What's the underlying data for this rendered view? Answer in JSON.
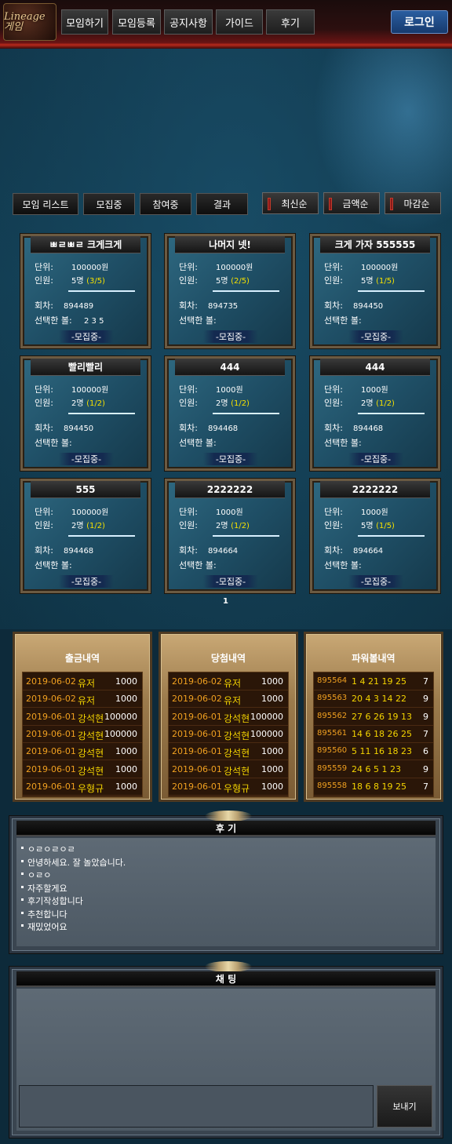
{
  "header": {
    "logo_text": "Lineage 게임",
    "nav": [
      "모임하기",
      "모임등록",
      "공지사항",
      "가이드",
      "후기"
    ],
    "login_label": "로그인"
  },
  "filters": {
    "tabs": [
      "모임 리스트",
      "모집중",
      "참여중",
      "결과"
    ],
    "sorts": [
      "최신순",
      "금액순",
      "마감순"
    ]
  },
  "card_labels": {
    "unit": "단위:",
    "members": "인원:",
    "round": "회차:",
    "picked": "선택한 볼:",
    "status": "-모집중-"
  },
  "cards": [
    {
      "title": "ㅃㄹㅃㄹ 크게크게",
      "unit": "100000원",
      "members": "5명",
      "count": "(3/5)",
      "round": "894489",
      "picked": "2 3 5"
    },
    {
      "title": "나머지 넷!",
      "unit": "100000원",
      "members": "5명",
      "count": "(2/5)",
      "round": "894735",
      "picked": ""
    },
    {
      "title": "크게 가자 555555",
      "unit": "100000원",
      "members": "5명",
      "count": "(1/5)",
      "round": "894450",
      "picked": ""
    },
    {
      "title": "빨리빨리",
      "unit": "100000원",
      "members": "2명",
      "count": "(1/2)",
      "round": "894450",
      "picked": ""
    },
    {
      "title": "444",
      "unit": "1000원",
      "members": "2명",
      "count": "(1/2)",
      "round": "894468",
      "picked": ""
    },
    {
      "title": "444",
      "unit": "1000원",
      "members": "2명",
      "count": "(1/2)",
      "round": "894468",
      "picked": ""
    },
    {
      "title": "555",
      "unit": "100000원",
      "members": "2명",
      "count": "(1/2)",
      "round": "894468",
      "picked": ""
    },
    {
      "title": "2222222",
      "unit": "1000원",
      "members": "2명",
      "count": "(1/2)",
      "round": "894664",
      "picked": ""
    },
    {
      "title": "2222222",
      "unit": "1000원",
      "members": "5명",
      "count": "(1/5)",
      "round": "894664",
      "picked": ""
    }
  ],
  "pager": {
    "current": "1"
  },
  "withdrawals": {
    "title": "출금내역",
    "rows": [
      {
        "date": "2019-06-02",
        "name": "유저",
        "amount": "1000"
      },
      {
        "date": "2019-06-02",
        "name": "유저",
        "amount": "1000"
      },
      {
        "date": "2019-06-01",
        "name": "강석현",
        "amount": "100000"
      },
      {
        "date": "2019-06-01",
        "name": "강석현",
        "amount": "100000"
      },
      {
        "date": "2019-06-01",
        "name": "강석현",
        "amount": "1000"
      },
      {
        "date": "2019-06-01",
        "name": "강석현",
        "amount": "1000"
      },
      {
        "date": "2019-06-01",
        "name": "우형규",
        "amount": "1000"
      }
    ]
  },
  "winnings": {
    "title": "당첨내역",
    "rows": [
      {
        "date": "2019-06-02",
        "name": "유저",
        "amount": "1000"
      },
      {
        "date": "2019-06-02",
        "name": "유저",
        "amount": "1000"
      },
      {
        "date": "2019-06-01",
        "name": "강석현",
        "amount": "100000"
      },
      {
        "date": "2019-06-01",
        "name": "강석현",
        "amount": "100000"
      },
      {
        "date": "2019-06-01",
        "name": "강석현",
        "amount": "1000"
      },
      {
        "date": "2019-06-01",
        "name": "강석현",
        "amount": "1000"
      },
      {
        "date": "2019-06-01",
        "name": "우형규",
        "amount": "1000"
      }
    ]
  },
  "powerball": {
    "title": "파워볼내역",
    "rows": [
      {
        "round": "895564",
        "nums": "1 4 21 19 25",
        "ball": "7"
      },
      {
        "round": "895563",
        "nums": "20 4 3 14 22",
        "ball": "9"
      },
      {
        "round": "895562",
        "nums": "27 6 26 19 13",
        "ball": "9"
      },
      {
        "round": "895561",
        "nums": "14 6 18 26 25",
        "ball": "7"
      },
      {
        "round": "895560",
        "nums": "5 11 16 18 23",
        "ball": "6"
      },
      {
        "round": "895559",
        "nums": "24 6 5 1 23",
        "ball": "9"
      },
      {
        "round": "895558",
        "nums": "18 6 8 19 25",
        "ball": "7"
      }
    ]
  },
  "reviews": {
    "title": "후 기",
    "items": [
      "ㅇㄹㅇㄹㅇㄹ",
      "안녕하세요. 잘 놀았습니다.",
      "ㅇㄹㅇ",
      "자주할게요",
      "후기작성합니다",
      "추천합니다",
      "재밌었어요"
    ]
  },
  "chat": {
    "title": "채 팅",
    "send_label": "보내기"
  },
  "colors": {
    "accent_yellow": "#f4e000",
    "log_date": "#f0a020",
    "header_red": "#b82a1c",
    "login_blue": "#2a5ea0"
  }
}
